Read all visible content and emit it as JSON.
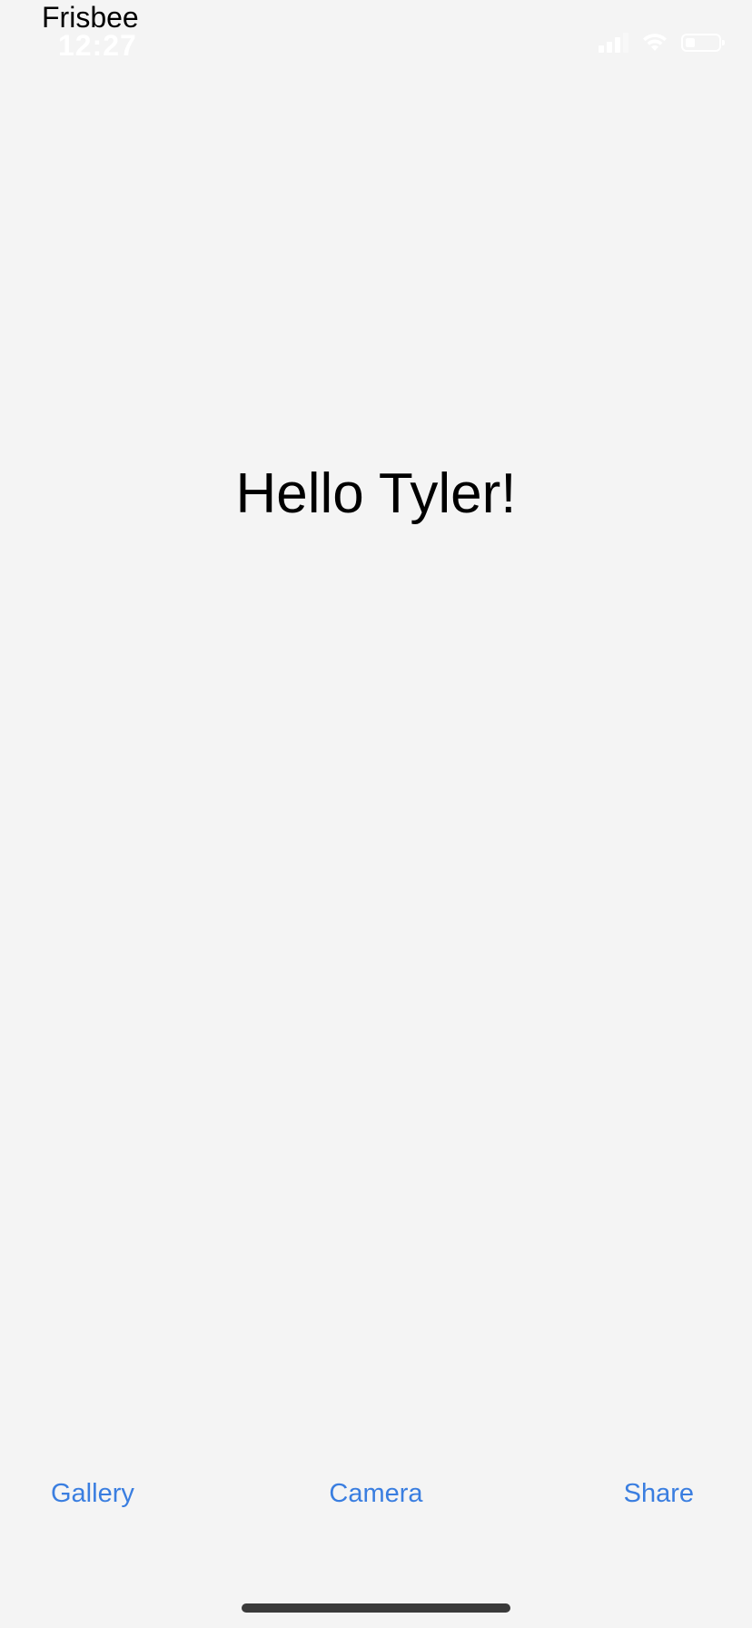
{
  "app": {
    "title": "Frisbee"
  },
  "status_bar": {
    "time": "12:27",
    "battery_level": 0.3
  },
  "main": {
    "greeting": "Hello Tyler!"
  },
  "toolbar": {
    "gallery_label": "Gallery",
    "camera_label": "Camera",
    "share_label": "Share"
  },
  "colors": {
    "background": "#f4f4f4",
    "accent": "#3a7ee0",
    "text": "#000000"
  }
}
